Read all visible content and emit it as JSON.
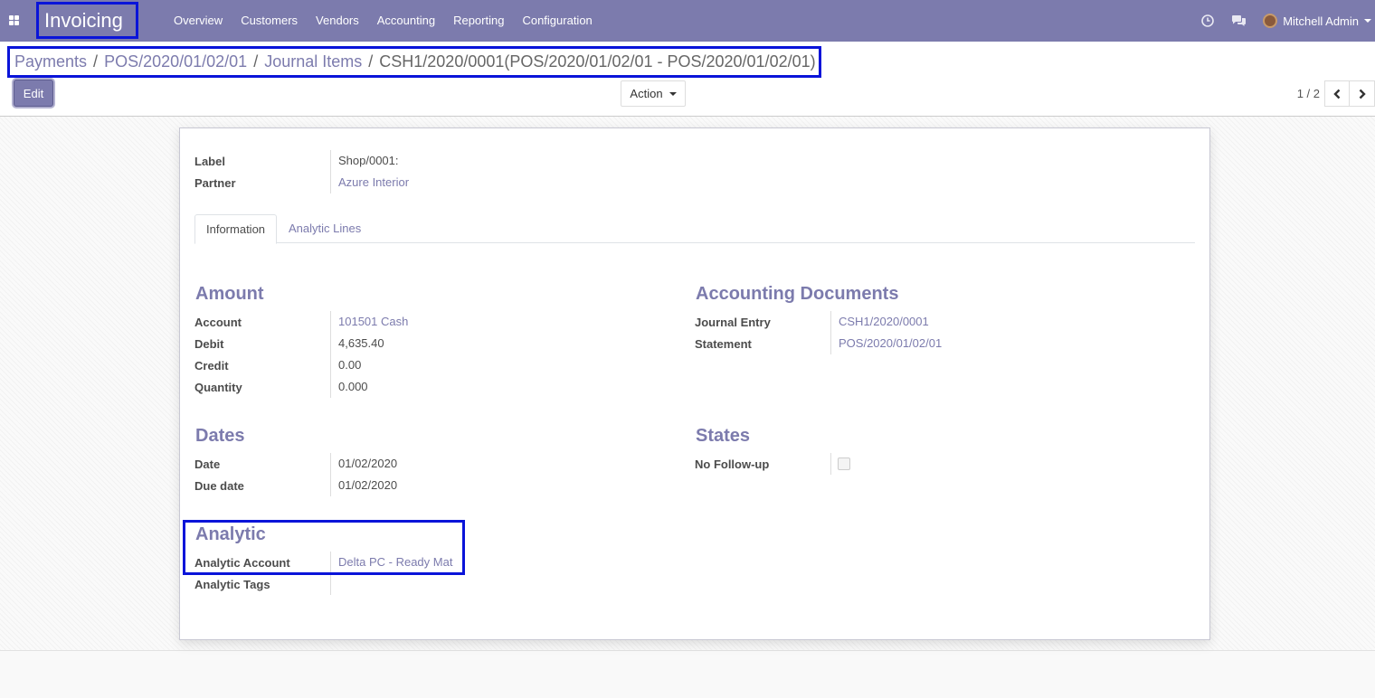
{
  "navbar": {
    "app_title": "Invoicing",
    "menu": [
      "Overview",
      "Customers",
      "Vendors",
      "Accounting",
      "Reporting",
      "Configuration"
    ],
    "user_name": "Mitchell Admin",
    "icons": [
      "apps-icon",
      "clock-icon",
      "chat-icon",
      "avatar"
    ],
    "color": "#7c7bad"
  },
  "breadcrumb": {
    "items": [
      "Payments",
      "POS/2020/01/02/01",
      "Journal Items"
    ],
    "active": "CSH1/2020/0001(POS/2020/01/02/01 - POS/2020/01/02/01)",
    "separator": "/"
  },
  "buttons": {
    "edit": "Edit",
    "action": "Action"
  },
  "pager": {
    "value": "1 / 2"
  },
  "form": {
    "label_field": {
      "label": "Label",
      "value": "Shop/0001:"
    },
    "partner_field": {
      "label": "Partner",
      "value": "Azure Interior"
    },
    "tabs": [
      "Information",
      "Analytic Lines"
    ],
    "amount": {
      "title": "Amount",
      "fields": [
        {
          "label": "Account",
          "value": "101501 Cash"
        },
        {
          "label": "Debit",
          "value": "4,635.40"
        },
        {
          "label": "Credit",
          "value": "0.00"
        },
        {
          "label": "Quantity",
          "value": "0.000"
        }
      ]
    },
    "accounting_documents": {
      "title": "Accounting Documents",
      "fields": [
        {
          "label": "Journal Entry",
          "value": "CSH1/2020/0001"
        },
        {
          "label": "Statement",
          "value": "POS/2020/01/02/01"
        }
      ]
    },
    "dates": {
      "title": "Dates",
      "fields": [
        {
          "label": "Date",
          "value": "01/02/2020"
        },
        {
          "label": "Due date",
          "value": "01/02/2020"
        }
      ]
    },
    "states": {
      "title": "States",
      "fields": [
        {
          "label": "No Follow-up",
          "checked": false
        }
      ]
    },
    "analytic": {
      "title": "Analytic",
      "fields": [
        {
          "label": "Analytic Account",
          "value": "Delta PC - Ready Mat"
        },
        {
          "label": "Analytic Tags",
          "value": ""
        }
      ]
    }
  }
}
